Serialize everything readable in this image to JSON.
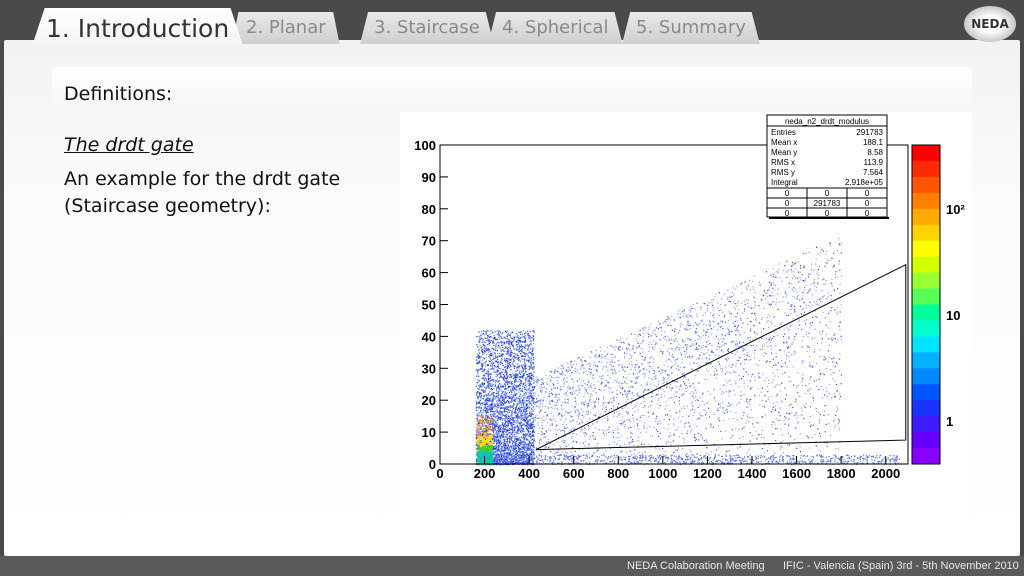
{
  "tabs": [
    {
      "label": "1. Introduction",
      "active": true
    },
    {
      "label": "2. Planar",
      "active": false
    },
    {
      "label": "3. Staircase",
      "active": false
    },
    {
      "label": "4. Spherical",
      "active": false
    },
    {
      "label": "5. Summary",
      "active": false
    }
  ],
  "logo": {
    "text": "NEDA"
  },
  "section": {
    "title": "Definitions:"
  },
  "content": {
    "subtitle": "The drdt gate",
    "description": "An example for the drdt gate (Staircase geometry):"
  },
  "footer": {
    "meeting": "NEDA Colaboration Meeting",
    "venue": "IFIC - Valencia (Spain) 3rd - 5th November 2010"
  },
  "chart_data": {
    "type": "heatmap",
    "x_ticks": [
      0,
      200,
      400,
      600,
      800,
      1000,
      1200,
      1400,
      1600,
      1800,
      2000
    ],
    "y_ticks": [
      0,
      10,
      20,
      30,
      40,
      50,
      60,
      70,
      80,
      90,
      100
    ],
    "xlim": [
      0,
      2100
    ],
    "ylim": [
      0,
      100
    ],
    "z_scale": "log",
    "z_labels": [
      "1",
      "10",
      "10²"
    ],
    "gate_polygon": [
      [
        430,
        4.5
      ],
      [
        2090,
        7.5
      ],
      [
        2090,
        62.5
      ],
      [
        430,
        4.5
      ]
    ],
    "stats": {
      "name": "neda_n2_drdt_modulus",
      "rows": [
        {
          "label": "Entries",
          "value": "291783"
        },
        {
          "label": "Mean x",
          "value": "188.1"
        },
        {
          "label": "Mean y",
          "value": "8.58"
        },
        {
          "label": "RMS x",
          "value": "113.9"
        },
        {
          "label": "RMS y",
          "value": "7.564"
        },
        {
          "label": "Integral",
          "value": "2.918e+05"
        }
      ],
      "grid": [
        [
          "0",
          "0",
          "0"
        ],
        [
          "0",
          "291783",
          "0"
        ],
        [
          "0",
          "0",
          "0"
        ]
      ]
    }
  },
  "colors": {
    "accent": "#2a4bd7",
    "gate": "#000000"
  }
}
